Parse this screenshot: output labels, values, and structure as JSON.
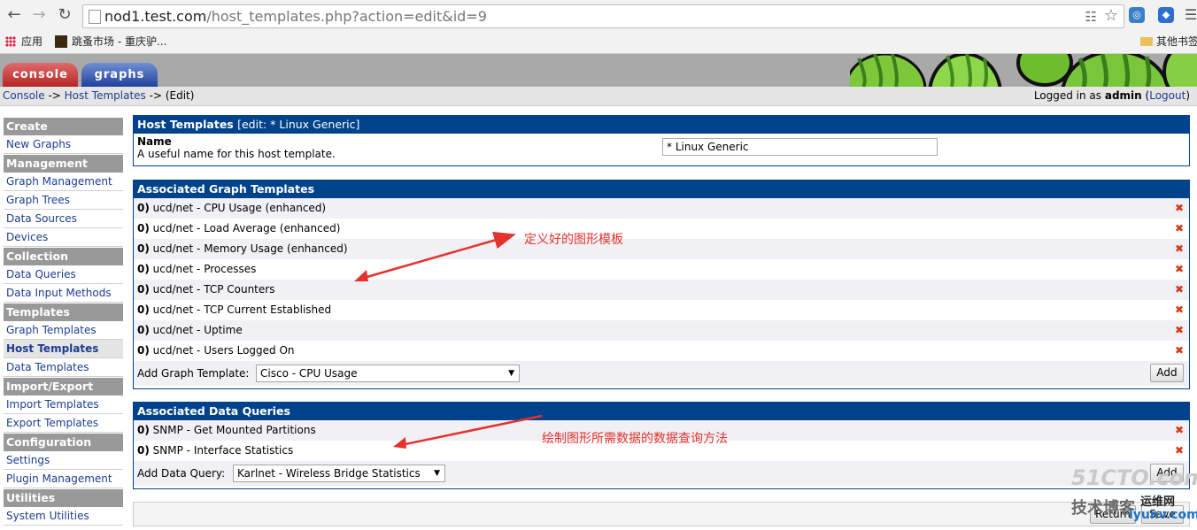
{
  "browser": {
    "url_host": "nod1.test.com",
    "url_path": "/host_templates.php?action=edit&id=9",
    "bookmarks": [
      {
        "label": "应用",
        "icon": "apps-grid-icon"
      },
      {
        "label": "跳蚤市场 - 重庆驴...",
        "icon": "site-favicon-icon"
      }
    ],
    "other_bookmarks": "其他书签"
  },
  "tabs": {
    "console": "console",
    "graphs": "graphs"
  },
  "breadcrumb": {
    "console": "Console",
    "sep1": " -> ",
    "host_templates": "Host Templates",
    "sep2": " -> ",
    "edit": "(Edit)"
  },
  "login": {
    "prefix": "Logged in as ",
    "user": "admin",
    "logout": "Logout"
  },
  "sidebar": [
    {
      "type": "header",
      "label": "Create"
    },
    {
      "type": "item",
      "label": "New Graphs"
    },
    {
      "type": "header",
      "label": "Management"
    },
    {
      "type": "item",
      "label": "Graph Management"
    },
    {
      "type": "item",
      "label": "Graph Trees"
    },
    {
      "type": "item",
      "label": "Data Sources"
    },
    {
      "type": "item",
      "label": "Devices"
    },
    {
      "type": "header",
      "label": "Collection Methods"
    },
    {
      "type": "item",
      "label": "Data Queries"
    },
    {
      "type": "item",
      "label": "Data Input Methods"
    },
    {
      "type": "header",
      "label": "Templates"
    },
    {
      "type": "item",
      "label": "Graph Templates"
    },
    {
      "type": "item",
      "label": "Host Templates",
      "selected": true
    },
    {
      "type": "item",
      "label": "Data Templates"
    },
    {
      "type": "header",
      "label": "Import/Export"
    },
    {
      "type": "item",
      "label": "Import Templates"
    },
    {
      "type": "item",
      "label": "Export Templates"
    },
    {
      "type": "header",
      "label": "Configuration"
    },
    {
      "type": "item",
      "label": "Settings"
    },
    {
      "type": "item",
      "label": "Plugin Management"
    },
    {
      "type": "header",
      "label": "Utilities"
    },
    {
      "type": "item",
      "label": "System Utilities"
    }
  ],
  "host_template": {
    "title": "Host Templates",
    "subtitle": "[edit: * Linux Generic]",
    "name_label": "Name",
    "name_desc": "A useful name for this host template.",
    "name_value": "* Linux Generic"
  },
  "graph_templates": {
    "title": "Associated Graph Templates",
    "items": [
      "ucd/net - CPU Usage (enhanced)",
      "ucd/net - Load Average (enhanced)",
      "ucd/net - Memory Usage (enhanced)",
      "ucd/net - Processes",
      "ucd/net - TCP Counters",
      "ucd/net - TCP Current Established",
      "ucd/net - Uptime",
      "ucd/net - Users Logged On"
    ],
    "index_prefix": "0)",
    "add_label": "Add Graph Template:",
    "add_selected": "Cisco - CPU Usage",
    "add_button": "Add",
    "delete_glyph": "✖"
  },
  "data_queries": {
    "title": "Associated Data Queries",
    "items": [
      "SNMP - Get Mounted Partitions",
      "SNMP - Interface Statistics"
    ],
    "add_label": "Add Data Query:",
    "add_selected": "Karlnet - Wireless Bridge Statistics",
    "add_button": "Add"
  },
  "bottom_buttons": {
    "return": "Return",
    "save": "Save"
  },
  "annotations": {
    "graph_note": "定义好的图形模板",
    "query_note": "绘制图形所需数据的数据查询方法",
    "note_color": "#e5322d"
  },
  "watermark": {
    "site": "51CTO.com",
    "tag": "技术博客",
    "blog": "运维网",
    "domain": "iyunv.com"
  }
}
